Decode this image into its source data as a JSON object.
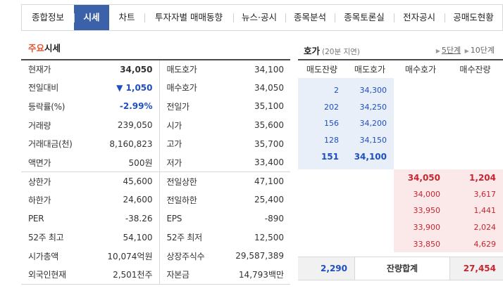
{
  "tabs": [
    {
      "label": "종합정보"
    },
    {
      "label": "시세",
      "active": true
    },
    {
      "label": "차트"
    },
    {
      "label": "투자자별 매매동향"
    },
    {
      "label": "뉴스·공시"
    },
    {
      "label": "종목분석"
    },
    {
      "label": "종목토론실"
    },
    {
      "label": "전자공시"
    },
    {
      "label": "공매도현황"
    }
  ],
  "price_section": {
    "title_accent": "주요",
    "title_rest": "시세",
    "rows": [
      {
        "l1": "현재가",
        "v1": "34,050",
        "l2": "매도호가",
        "v2": "34,100"
      },
      {
        "l1": "전일대비",
        "v1": "▼ 1,050",
        "l2": "매수호가",
        "v2": "34,050"
      },
      {
        "l1": "등락률(%)",
        "v1": "-2.99%",
        "l2": "전일가",
        "v2": "35,100"
      },
      {
        "l1": "거래량",
        "v1": "239,050",
        "l2": "시가",
        "v2": "35,600"
      },
      {
        "l1": "거래대금(천)",
        "v1": "8,160,823",
        "l2": "고가",
        "v2": "35,700"
      },
      {
        "l1": "액면가",
        "v1": "500원",
        "l2": "저가",
        "v2": "33,400"
      },
      {
        "l1": "상한가",
        "v1": "45,600",
        "l2": "전일상한",
        "v2": "47,100"
      },
      {
        "l1": "하한가",
        "v1": "24,600",
        "l2": "전일하한",
        "v2": "25,400"
      },
      {
        "l1": "PER",
        "v1": "-38.26",
        "l2": "EPS",
        "v2": "-890"
      },
      {
        "l1": "52주 최고",
        "v1": "54,100",
        "l2": "52주 최저",
        "v2": "12,500"
      },
      {
        "l1": "시가총액",
        "v1": "10,074억원",
        "l2": "상장주식수",
        "v2": "29,587,389"
      },
      {
        "l1": "외국인현재",
        "v1": "2,501천주",
        "l2": "자본금",
        "v2": "14,793백만"
      }
    ]
  },
  "hoga": {
    "title": "호가",
    "subtitle": "(20분 지연)",
    "level_5": "5단계",
    "level_10": "10단계",
    "headers": [
      "매도잔량",
      "매도호가",
      "매수호가",
      "매수잔량"
    ],
    "asks": [
      {
        "qty": "2",
        "price": "34,300"
      },
      {
        "qty": "202",
        "price": "34,250"
      },
      {
        "qty": "156",
        "price": "34,200"
      },
      {
        "qty": "128",
        "price": "34,150"
      },
      {
        "qty": "151",
        "price": "34,100"
      }
    ],
    "bids": [
      {
        "price": "34,050",
        "qty": "1,204"
      },
      {
        "price": "34,000",
        "qty": "3,617"
      },
      {
        "price": "33,950",
        "qty": "1,441"
      },
      {
        "price": "33,900",
        "qty": "2,024"
      },
      {
        "price": "33,850",
        "qty": "4,629"
      }
    ],
    "total_ask": "2,290",
    "total_label": "잔량합계",
    "total_bid": "27,454"
  },
  "colors": {
    "tab_active": "#3b61a8",
    "down_blue": "#1d4ec3",
    "up_red": "#c7252f",
    "title_accent": "#e8542f",
    "ask_bg": "#e8eff9",
    "bid_bg": "#fbe9ea"
  }
}
